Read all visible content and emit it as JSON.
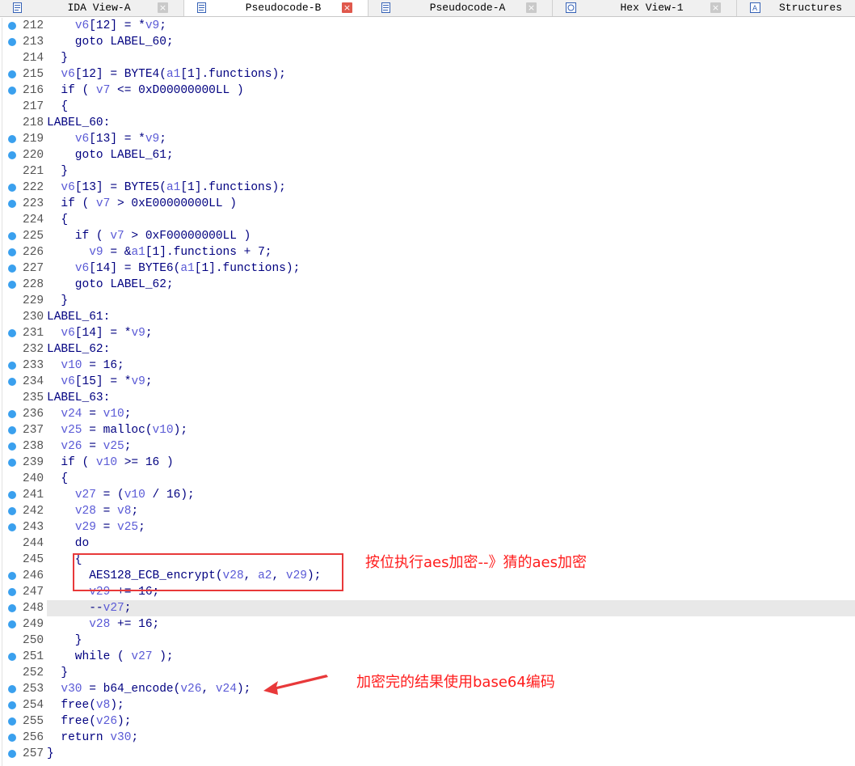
{
  "tabs": [
    {
      "label": "IDA View-A",
      "icon": "disassembly-icon",
      "active": false
    },
    {
      "label": "Pseudocode-B",
      "icon": "pseudocode-icon",
      "active": true
    },
    {
      "label": "Pseudocode-A",
      "icon": "pseudocode-icon",
      "active": false
    },
    {
      "label": "Hex View-1",
      "icon": "hex-view-icon",
      "active": false
    },
    {
      "label": "Structures",
      "icon": "structures-icon",
      "active": false
    }
  ],
  "close_glyph": "×",
  "code_lines": [
    {
      "num": "212",
      "dot": true,
      "text": "    v6[12] = *v9;"
    },
    {
      "num": "213",
      "dot": true,
      "text": "    goto LABEL_60;"
    },
    {
      "num": "214",
      "dot": false,
      "text": "  }"
    },
    {
      "num": "215",
      "dot": true,
      "text": "  v6[12] = BYTE4(a1[1].functions);"
    },
    {
      "num": "216",
      "dot": true,
      "text": "  if ( v7 <= 0xD00000000LL )"
    },
    {
      "num": "217",
      "dot": false,
      "text": "  {"
    },
    {
      "num": "218",
      "dot": false,
      "text": "LABEL_60:"
    },
    {
      "num": "219",
      "dot": true,
      "text": "    v6[13] = *v9;"
    },
    {
      "num": "220",
      "dot": true,
      "text": "    goto LABEL_61;"
    },
    {
      "num": "221",
      "dot": false,
      "text": "  }"
    },
    {
      "num": "222",
      "dot": true,
      "text": "  v6[13] = BYTE5(a1[1].functions);"
    },
    {
      "num": "223",
      "dot": true,
      "text": "  if ( v7 > 0xE00000000LL )"
    },
    {
      "num": "224",
      "dot": false,
      "text": "  {"
    },
    {
      "num": "225",
      "dot": true,
      "text": "    if ( v7 > 0xF00000000LL )"
    },
    {
      "num": "226",
      "dot": true,
      "text": "      v9 = &a1[1].functions + 7;"
    },
    {
      "num": "227",
      "dot": true,
      "text": "    v6[14] = BYTE6(a1[1].functions);"
    },
    {
      "num": "228",
      "dot": true,
      "text": "    goto LABEL_62;"
    },
    {
      "num": "229",
      "dot": false,
      "text": "  }"
    },
    {
      "num": "230",
      "dot": false,
      "text": "LABEL_61:"
    },
    {
      "num": "231",
      "dot": true,
      "text": "  v6[14] = *v9;"
    },
    {
      "num": "232",
      "dot": false,
      "text": "LABEL_62:"
    },
    {
      "num": "233",
      "dot": true,
      "text": "  v10 = 16;"
    },
    {
      "num": "234",
      "dot": true,
      "text": "  v6[15] = *v9;"
    },
    {
      "num": "235",
      "dot": false,
      "text": "LABEL_63:"
    },
    {
      "num": "236",
      "dot": true,
      "text": "  v24 = v10;"
    },
    {
      "num": "237",
      "dot": true,
      "text": "  v25 = malloc(v10);"
    },
    {
      "num": "238",
      "dot": true,
      "text": "  v26 = v25;"
    },
    {
      "num": "239",
      "dot": true,
      "text": "  if ( v10 >= 16 )"
    },
    {
      "num": "240",
      "dot": false,
      "text": "  {"
    },
    {
      "num": "241",
      "dot": true,
      "text": "    v27 = (v10 / 16);"
    },
    {
      "num": "242",
      "dot": true,
      "text": "    v28 = v8;"
    },
    {
      "num": "243",
      "dot": true,
      "text": "    v29 = v25;"
    },
    {
      "num": "244",
      "dot": false,
      "text": "    do"
    },
    {
      "num": "245",
      "dot": false,
      "text": "    {"
    },
    {
      "num": "246",
      "dot": true,
      "text": "      AES128_ECB_encrypt(v28, a2, v29);"
    },
    {
      "num": "247",
      "dot": true,
      "text": "      v29 += 16;"
    },
    {
      "num": "248",
      "dot": true,
      "text": "      --v27;",
      "highlight": true
    },
    {
      "num": "249",
      "dot": true,
      "text": "      v28 += 16;"
    },
    {
      "num": "250",
      "dot": false,
      "text": "    }"
    },
    {
      "num": "251",
      "dot": true,
      "text": "    while ( v27 );"
    },
    {
      "num": "252",
      "dot": false,
      "text": "  }"
    },
    {
      "num": "253",
      "dot": true,
      "text": "  v30 = b64_encode(v26, v24);"
    },
    {
      "num": "254",
      "dot": true,
      "text": "  free(v8);"
    },
    {
      "num": "255",
      "dot": true,
      "text": "  free(v26);"
    },
    {
      "num": "256",
      "dot": true,
      "text": "  return v30;"
    },
    {
      "num": "257",
      "dot": true,
      "text": "}"
    }
  ],
  "annotations": {
    "aes_note": "按位执行aes加密--》猜的aes加密",
    "base64_note": "加密完的结果使用base64编码"
  },
  "colors": {
    "annotation": "#ff1c1c",
    "breakpoint_dot": "#3aa0ee",
    "code_text": "#000080",
    "variable": "#5a5ad6",
    "highlight_line": "#e8e8e8"
  }
}
